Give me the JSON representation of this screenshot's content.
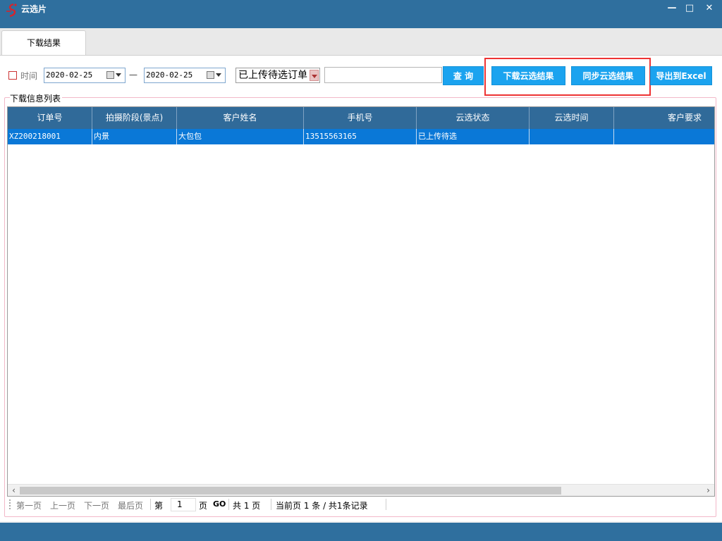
{
  "window": {
    "title": "云选片",
    "controls": {
      "minimize": "—",
      "maximize": "□",
      "close": "✕"
    }
  },
  "tabs": [
    {
      "label": "下载结果",
      "active": true
    }
  ],
  "toolbar": {
    "time_checkbox_label": "时间",
    "time_checked": false,
    "date_from": "2020-02-25",
    "date_to": "2020-02-25",
    "date_separator": "—",
    "status_select": "已上传待选订单",
    "search_value": "",
    "buttons": {
      "query": "查 询",
      "download": "下载云选结果",
      "sync": "同步云选结果",
      "export": "导出到Excel"
    }
  },
  "group": {
    "title": "下载信息列表"
  },
  "grid": {
    "columns": [
      "订单号",
      "拍摄阶段(景点)",
      "客户姓名",
      "手机号",
      "云选状态",
      "云选时间",
      "客户要求"
    ],
    "rows": [
      [
        "XZ200218001",
        "内景",
        "大包包",
        "13515563165",
        "已上传待选",
        "",
        ""
      ]
    ]
  },
  "pager": {
    "first": "第一页",
    "prev": "上一页",
    "next": "下一页",
    "last": "最后页",
    "page_prefix": "第",
    "page_value": "1",
    "page_suffix": "页",
    "go": "GO",
    "total_pages_text": "共 1 页",
    "current_text": "当前页 1 条 / 共1条记录"
  },
  "colors": {
    "titlebar": "#2f6f9e",
    "header": "#306a99",
    "selected_row": "#0a78d7",
    "button": "#1ba3ef",
    "highlight_border": "#e33333"
  },
  "icons": {
    "logo": "app-logo-icon",
    "calendar": "calendar-icon",
    "dropdown": "chevron-down-icon",
    "scroll_left": "chevron-left-icon",
    "scroll_right": "chevron-right-icon"
  }
}
